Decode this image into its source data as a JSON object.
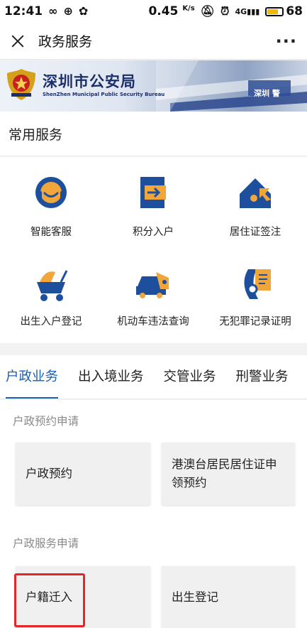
{
  "status_bar": {
    "time": "12:41",
    "speed_value": "0.45",
    "speed_unit": "K/s",
    "network": "4G",
    "battery": "68"
  },
  "nav": {
    "title": "政务服务",
    "more": "···"
  },
  "banner": {
    "title": "深圳市公安局",
    "subtitle": "ShenZhen Municipal Public Security Bureau",
    "sign_text": "深圳 警"
  },
  "common": {
    "header": "常用服务",
    "items": [
      {
        "label": "智能客服",
        "icon": "customer-service-icon"
      },
      {
        "label": "积分入户",
        "icon": "points-household-icon"
      },
      {
        "label": "居住证签注",
        "icon": "residence-permit-icon"
      },
      {
        "label": "出生入户登记",
        "icon": "birth-registration-icon"
      },
      {
        "label": "机动车违法查询",
        "icon": "vehicle-violation-icon"
      },
      {
        "label": "无犯罪记录证明",
        "icon": "no-criminal-record-icon"
      }
    ]
  },
  "tabs": [
    {
      "label": "户政业务",
      "active": true
    },
    {
      "label": "出入境业务",
      "active": false
    },
    {
      "label": "交管业务",
      "active": false
    },
    {
      "label": "刑警业务",
      "active": false
    }
  ],
  "groups": [
    {
      "label": "户政预约申请",
      "cards": [
        "户政预约",
        "港澳台居民居住证申领预约"
      ]
    },
    {
      "label": "户政服务申请",
      "cards": [
        "户籍迁入",
        "出生登记"
      ]
    }
  ],
  "colors": {
    "accent": "#1a5fb4",
    "icon_blue": "#1d4f9c",
    "icon_orange": "#f0a63a",
    "highlight": "#e4262b"
  }
}
